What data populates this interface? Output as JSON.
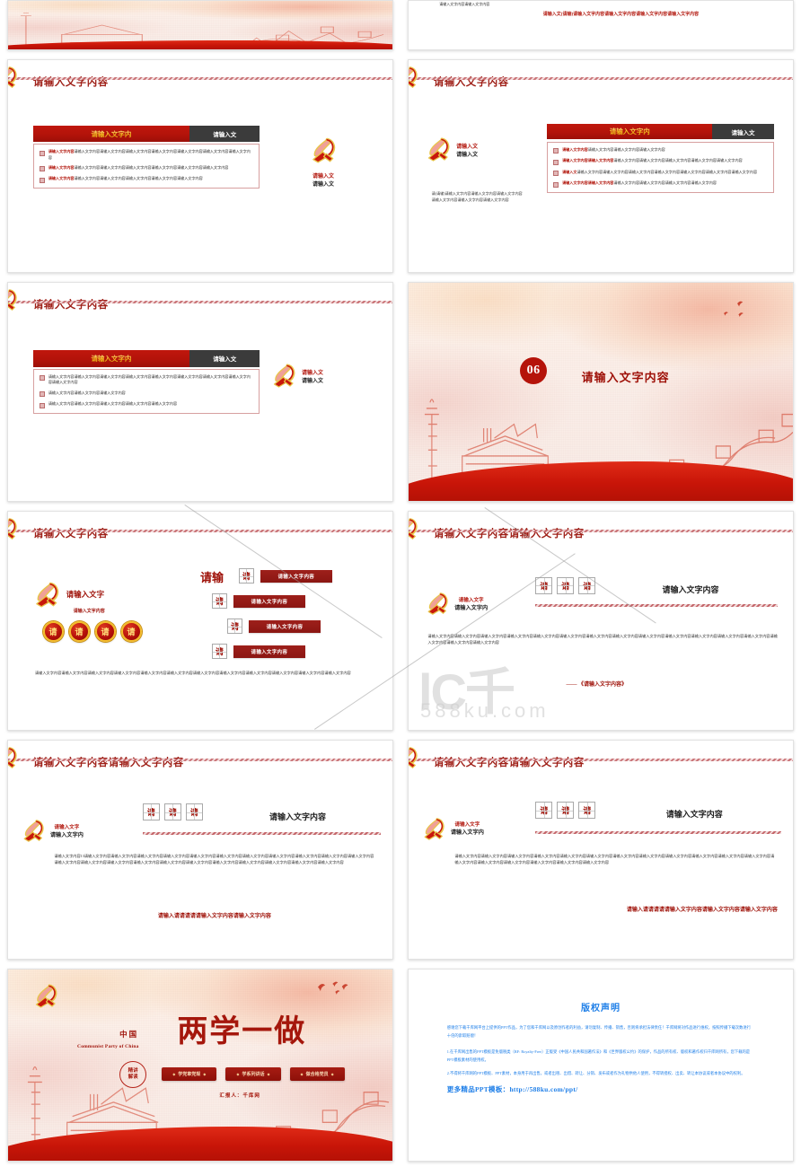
{
  "meta": {
    "placeholder_text": "请输入文字内容",
    "placeholder_short": "请输入文字内",
    "placeholder_shorter": "请输入文",
    "placeholder_char": "请",
    "brand_accent": "#b3130a",
    "brand_dark": "#3b3b3b",
    "title_color": "#9e1f17",
    "copyright_color": "#1f7fe8"
  },
  "watermark": {
    "logo": "lC千",
    "site": "588ku.com"
  },
  "slides": {
    "s01_partial": {
      "name": "cover-banner-partial",
      "kind": "scenic-partial"
    },
    "s02_partial": {
      "name": "text-slide-partial",
      "small_text": "请输入文字内容请输入文字内容",
      "red_text": "请输入文(请输)请输入文字内容请输入文字内容请输入文字内容请输入文字内容"
    },
    "s03": {
      "title": "请输入文字内容",
      "bar_red": "请输入文字内",
      "bar_dark": "请输入文",
      "bullets": [
        {
          "lead": "请输入文字内容",
          "rest": "请输入文字内容请输入文字内容请输入文字内容请输入文字内容请输入文字内容请输入文字内容请输入文字内容"
        },
        {
          "lead": "请输入文字内容",
          "rest": "请输入文字内容请输入文字内容请输入文字内容请输入文字内容请输入文字内容请输入文字内容"
        },
        {
          "lead": "请输入文字内容",
          "rest": "请输入文字内容请输入文字内容请输入文字内容请输入文字内容请输入文字内容"
        }
      ],
      "side_label_1": "请输入文",
      "side_label_2": "请输入文"
    },
    "s04": {
      "title": "请输入文字内容",
      "bar_red": "请输入文字内",
      "bar_dark": "请输入文",
      "side_label_1": "请输入文",
      "side_label_2": "请输入文",
      "side_paragraph": "请(请输)请输入文字内容请输入文字内容请输入文字内容请输入文字内容请输入文字内容请输入文字内容",
      "bullets": [
        {
          "lead": "请输入文字内容",
          "rest": "请输入文字内容请输入文字内容请输入文字内容"
        },
        {
          "lead": "请输入文字内容请输入文字内容",
          "rest": "请输入文字内容请输入文字内容请输入文字内容请输入文字内容请输入文字内容"
        },
        {
          "lead": "请输入文",
          "rest": "请输入文字内容请输入文字内容请输入文字内容请输入文字内容请输入文字内容请输入文字内容请输入文字内容"
        },
        {
          "lead": "请输入文字内容请输入文字内容",
          "rest": "请输入文字内容请输入文字内容请输入文字内容请输入文字内容"
        }
      ]
    },
    "s05": {
      "title": "请输入文字内容",
      "bar_red": "请输入文字内",
      "bar_dark": "请输入文",
      "bullets": [
        {
          "lead": "",
          "rest": "请输入文字内容请输入文字内容请输入文字内容请输入文字内容请输入文字内容请输入文字内容请输入文字内容请输入文字内容请输入文字内容"
        },
        {
          "lead": "",
          "rest": "请输入文字内容请输入文字内容请输入文字内容"
        },
        {
          "lead": "",
          "rest": "请输入文字内容请输入文字内容请输入文字内容请输入文字内容请输入文字内容"
        }
      ],
      "side_label_1": "请输入文",
      "side_label_2": "请输入文"
    },
    "s06": {
      "number": "06",
      "title": "请输入文字内容",
      "kind": "section-divider"
    },
    "s07": {
      "title": "请输入文字内容",
      "emblem_label": "请输入文字",
      "emblem_sub": "请输入文字内容",
      "big_label": "请输",
      "circles": [
        "请",
        "请",
        "请",
        "请"
      ],
      "steps": [
        {
          "char": "请",
          "bar": "请输入文字内容"
        },
        {
          "char": "请",
          "bar": "请输入文字内容"
        },
        {
          "char": "请",
          "bar": "请输入文字内容"
        },
        {
          "char": "请",
          "bar": "请输入文字内容"
        }
      ],
      "footer": "请输入文字内容请输入文字内容请输入文字内容请输入文字内容请输入文字内容请输入文字内容请输入文字内容请输入文字内容请输入文字内容请输入文字内容请输入文字内容请输入文字内容"
    },
    "s08": {
      "title": "请输入文字内容请输入文字内容",
      "emblem_label_1": "请输入文字",
      "emblem_label_2": "请输入文字内",
      "boxes": [
        "请",
        "请",
        "请"
      ],
      "heading_right": "请输入文字内容",
      "body": "请输入文字内容请输入文字内容请输入文字内容请输入文字内容请输入文字内容请输入文字内容请输入文字内容请输入文字内容请输入文字内容请输入文字内容请输入文字内容请输入文字内容请输入文字内容请输入文字内容请输入文字内容请输入文字内容",
      "source": "—— 《请输入文字内容》"
    },
    "s09": {
      "title": "请输入文字内容请输入文字内容",
      "emblem_label_1": "请输入文字",
      "emblem_label_2": "请输入文字内",
      "boxes": [
        "请",
        "请",
        "请"
      ],
      "heading_right": "请输入文字内容",
      "body": "请输入文字内容13请输入文字内容请输入文字内容请输入文字内容请输入文字内容请输入文字内容请输入文字内容请输入文字内容请输入文字内容请输入文字内容请输入文字内容请输入文字内容请输入文字内容请输入文字内容请输入文字内容请输入文字内容请输入文字内容请输入文字内容请输入文字内容请输入文字内容请输入文字内容请输入文字内容请输入文字内容",
      "source": "请输入请请请请请输入文字内容请输入文字内容"
    },
    "s10": {
      "title": "请输入文字内容请输入文字内容",
      "emblem_label_1": "请输入文字",
      "emblem_label_2": "请输入文字内",
      "boxes": [
        "请",
        "请",
        "请"
      ],
      "heading_right": "请输入文字内容",
      "body": "请输入文字内容请输入文字内容请输入文字内容请输入文字内容请输入文字内容请输入文字内容请输入文字内容请输入文字内容请输入文字内容请输入文字内容请输入文字内容请输入文字内容请输入文字内容请输入文字内容请输入文字内容请输入文字内容请输入文字内容请输入文字内容",
      "source": "请输入请请请请请输入文字内容请输入文字内容请输入文字内容"
    },
    "s11_title": {
      "cn": "中国",
      "en": "Communist Party of China",
      "main": "两学一做",
      "seal_line1": "精讲",
      "seal_line2": "解读",
      "pills": [
        "学党章党规",
        "学系列讲话",
        "做合格党员"
      ],
      "presenter": "汇报人：千库网"
    },
    "s12_copyright": {
      "heading": "版权声明",
      "para1": "感谢您下载千库网平台上提供的PPT作品，为了您和千库网以及原创作者的利益，请勿复制、传播、销售，否则将承担法律责任！千库网将对作品进行维权，按照传播下载次数进行十倍的索取赔偿！",
      "para2": "1.在千库网出售的PPT模板是免版税类（RF: Royalty-Free）正版受《中国人民共和国著作法》和《世界版权公约》的保护，作品的所有权、版权和著作权归千库网所有，您下载的是PPT模板素材的使用权。",
      "para3": "2.不得将千库网的PPT模板、PPT素材，本身用于再出售，或者出租、出借、转让、分销、发布或者作为礼物供他人使用，不得转授权、出卖、转让本协议或者本协议中的权利。",
      "more": "更多精品PPT模板：http://588ku.com/ppt/"
    }
  }
}
